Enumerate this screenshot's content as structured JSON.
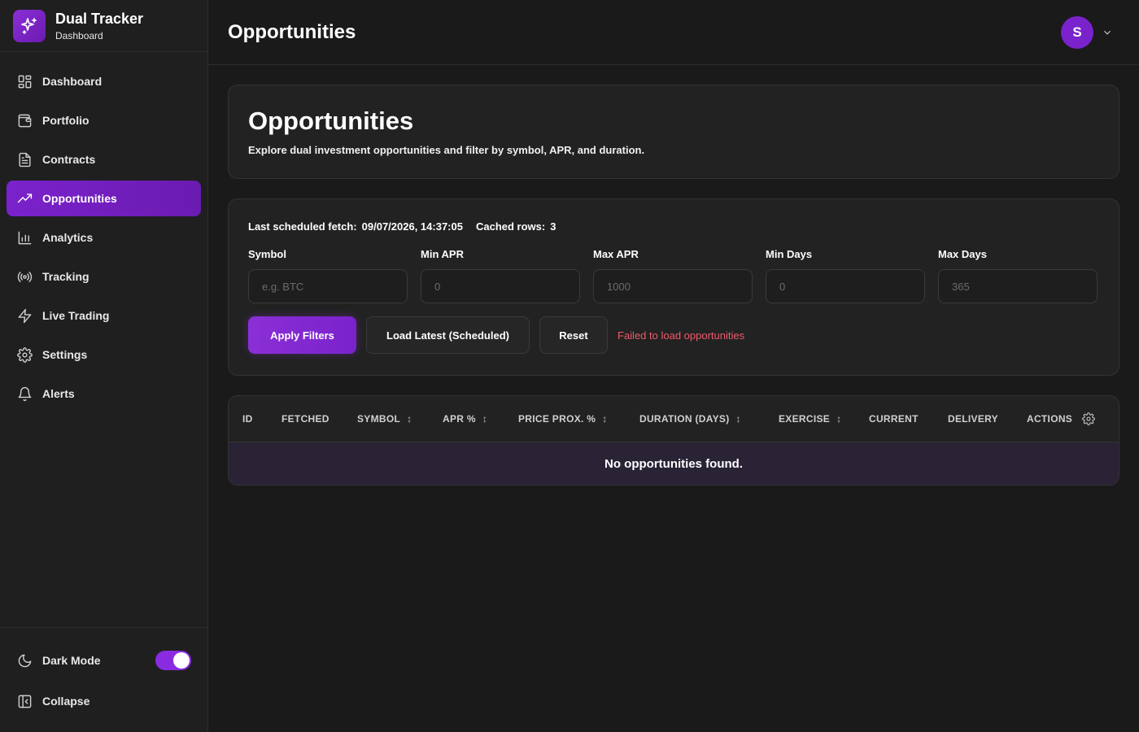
{
  "brand": {
    "title": "Dual Tracker",
    "subtitle": "Dashboard",
    "logo_icon": "sparkles-icon"
  },
  "sidebar": {
    "items": [
      {
        "label": "Dashboard",
        "icon": "grid-icon"
      },
      {
        "label": "Portfolio",
        "icon": "wallet-icon"
      },
      {
        "label": "Contracts",
        "icon": "document-icon"
      },
      {
        "label": "Opportunities",
        "icon": "trending-up-icon",
        "active": true
      },
      {
        "label": "Analytics",
        "icon": "bar-chart-icon"
      },
      {
        "label": "Tracking",
        "icon": "broadcast-icon"
      },
      {
        "label": "Live Trading",
        "icon": "lightning-icon"
      },
      {
        "label": "Settings",
        "icon": "gear-icon"
      },
      {
        "label": "Alerts",
        "icon": "bell-icon"
      }
    ],
    "dark_mode_label": "Dark Mode",
    "dark_mode_on": true,
    "collapse_label": "Collapse"
  },
  "header": {
    "title": "Opportunities",
    "avatar_initial": "S"
  },
  "intro": {
    "title": "Opportunities",
    "description": "Explore dual investment opportunities and filter by symbol, APR, and duration."
  },
  "filters": {
    "fetch_label": "Last scheduled fetch:",
    "fetch_value": "09/07/2026, 14:37:05",
    "cached_label": "Cached rows:",
    "cached_value": "3",
    "fields": [
      {
        "label": "Symbol",
        "placeholder": "e.g. BTC"
      },
      {
        "label": "Min APR",
        "placeholder": "0"
      },
      {
        "label": "Max APR",
        "placeholder": "1000"
      },
      {
        "label": "Min Days",
        "placeholder": "0"
      },
      {
        "label": "Max Days",
        "placeholder": "365"
      }
    ],
    "apply_label": "Apply Filters",
    "load_label": "Load Latest (Scheduled)",
    "reset_label": "Reset",
    "error_text": "Failed to load opportunities"
  },
  "table": {
    "columns": [
      "ID",
      "FETCHED",
      "SYMBOL",
      "APR %",
      "PRICE PROX. %",
      "DURATION (DAYS)",
      "EXERCISE",
      "CURRENT",
      "DELIVERY",
      "ACTIONS"
    ],
    "sort_glyph": "↕",
    "empty_text": "No opportunities found."
  },
  "colors": {
    "accent": "#7a22cc",
    "error": "#ef5a6a",
    "background": "#1a1a1a"
  }
}
